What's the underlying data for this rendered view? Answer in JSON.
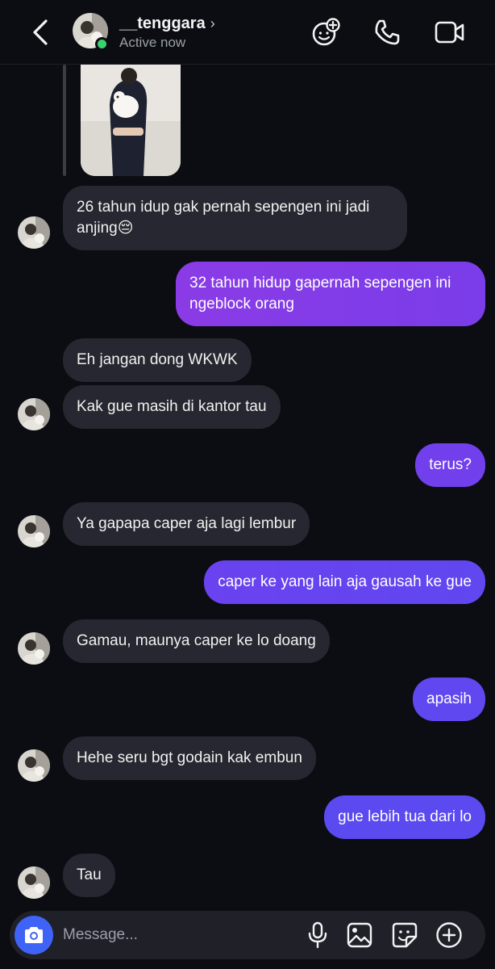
{
  "header": {
    "username": "__tenggara",
    "status": "Active now",
    "icons": [
      "back-chevron-icon",
      "chevron-right-icon",
      "ai-sparkle-icon",
      "phone-icon",
      "video-camera-icon"
    ]
  },
  "colors": {
    "background": "#0b0d12",
    "incoming_bubble": "#262730",
    "outgoing_gradient_start": "#8a3be6",
    "outgoing_gradient_end": "#5b4af0",
    "online": "#3bd16f",
    "camera_button": "#3f63f7"
  },
  "messages": [
    {
      "side": "in",
      "text": "26 tahun idup gak pernah sepengen ini jadi anjing😔",
      "avatar": true
    },
    {
      "side": "out",
      "text": "32 tahun hidup gapernah sepengen ini ngeblock orang"
    },
    {
      "side": "in",
      "text": "Eh jangan dong WKWK",
      "avatar": false
    },
    {
      "side": "in",
      "text": "Kak gue masih di kantor tau",
      "avatar": true
    },
    {
      "side": "out",
      "text": "terus?"
    },
    {
      "side": "in",
      "text": "Ya gapapa caper aja lagi lembur",
      "avatar": true
    },
    {
      "side": "out",
      "text": "caper ke yang lain aja gausah ke gue"
    },
    {
      "side": "in",
      "text": "Gamau, maunya caper ke lo doang",
      "avatar": true
    },
    {
      "side": "out",
      "text": "apasih"
    },
    {
      "side": "in",
      "text": "Hehe seru bgt godain kak embun",
      "avatar": true
    },
    {
      "side": "out",
      "text": "gue lebih tua dari lo"
    },
    {
      "side": "in",
      "text": "Tau",
      "avatar": true
    }
  ],
  "composer": {
    "placeholder": "Message...",
    "icons": [
      "camera-icon",
      "microphone-icon",
      "gallery-icon",
      "sticker-icon",
      "plus-circle-icon"
    ]
  }
}
